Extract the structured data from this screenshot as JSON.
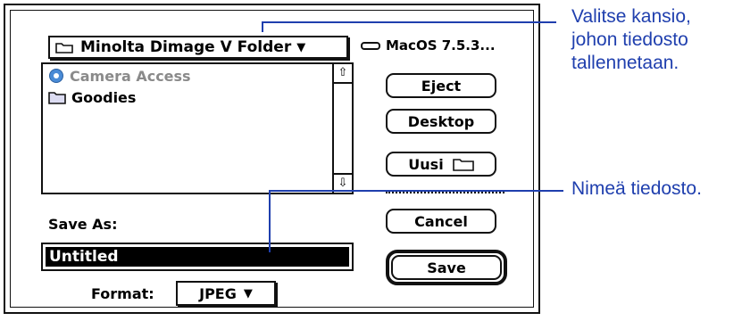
{
  "dialog": {
    "folder_popup": "Minolta Dimage V Folder",
    "disk_name": "MacOS 7.5.3...",
    "file_list": [
      {
        "name": "Camera Access",
        "icon": "app-icon",
        "dimmed": true
      },
      {
        "name": "Goodies",
        "icon": "folder-icon",
        "dimmed": false
      }
    ],
    "buttons": {
      "eject": "Eject",
      "desktop": "Desktop",
      "new_folder": "Uusi",
      "cancel": "Cancel",
      "save": "Save"
    },
    "save_as_label": "Save As:",
    "name_value": "Untitled",
    "format_label": "Format:",
    "format_value": "JPEG"
  },
  "callouts": {
    "folder_hint": [
      "Valitse kansio,",
      "johon tiedosto",
      "tallennetaan."
    ],
    "name_hint": "Nimeä tiedosto."
  },
  "colors": {
    "callout": "#1f3fae",
    "selection": "#000000"
  }
}
